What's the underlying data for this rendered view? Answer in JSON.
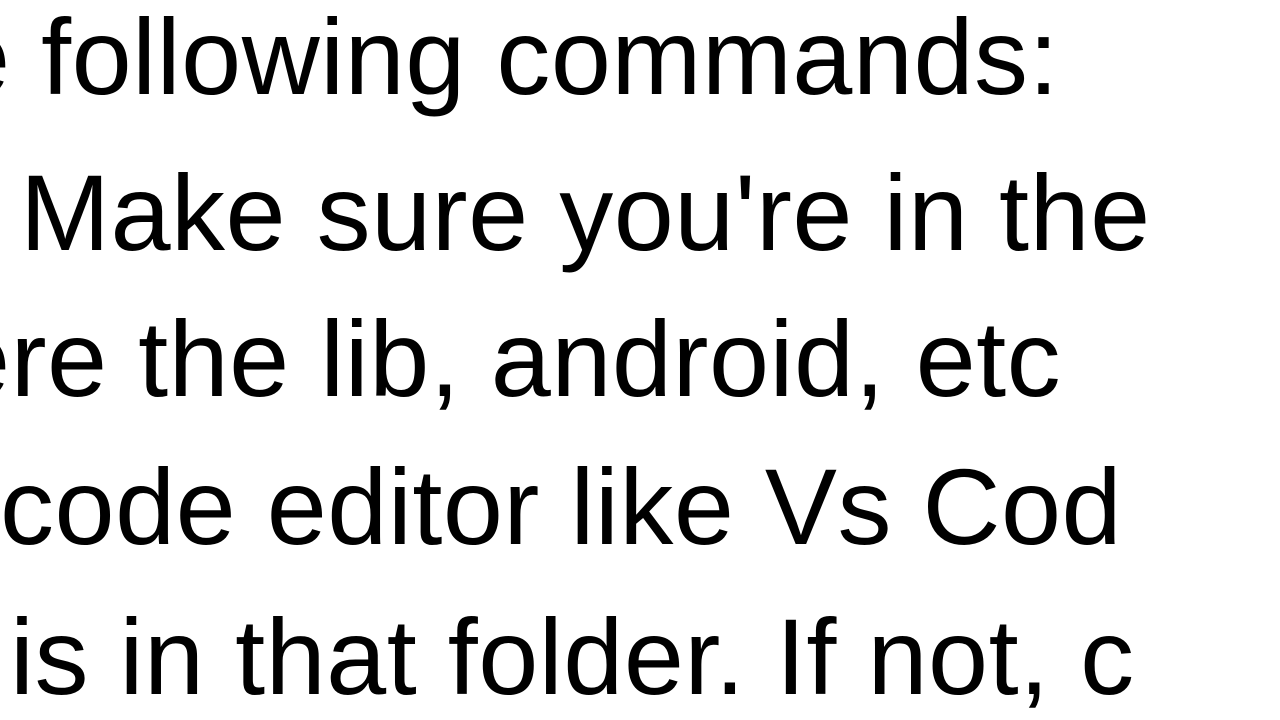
{
  "lines": {
    "l1": "e following commands:",
    "l2": "Make sure you're in the",
    "l3": "ere the lib, android, etc",
    "l4": "code editor like Vs Cod",
    "l5": "is in that folder. If not, c"
  }
}
